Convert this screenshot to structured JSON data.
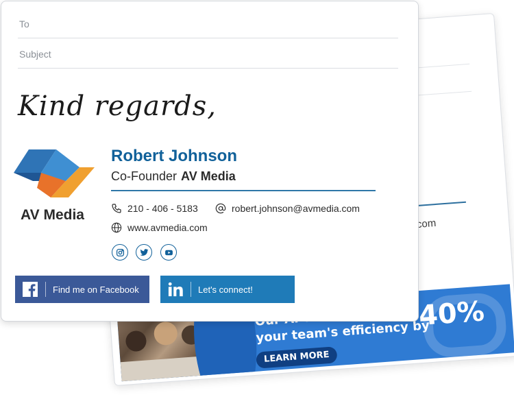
{
  "back_card": {
    "url_fragment": "ia.com",
    "banner": {
      "line1": "Our AI Toolkit will",
      "line2": "your team's efficiency by",
      "percent": "40%",
      "cta": "LEARN MORE"
    }
  },
  "email": {
    "to_placeholder": "To",
    "subject_placeholder": "Subject"
  },
  "signature": {
    "signoff": "Kind regards,",
    "logo_text": "AV Media",
    "name": "Robert Johnson",
    "role": "Co-Founder",
    "company": "AV Media",
    "phone": "210 - 406 - 5183",
    "email": "robert.johnson@avmedia.com",
    "website": "www.avmedia.com",
    "social": [
      "instagram-icon",
      "twitter-icon",
      "youtube-icon"
    ],
    "buttons": {
      "facebook": "Find me on Facebook",
      "linkedin": "Let's connect!"
    }
  },
  "colors": {
    "name_blue": "#11619a",
    "facebook": "#3b5998",
    "linkedin": "#1f7bb8",
    "banner": "#2f7bd3"
  }
}
